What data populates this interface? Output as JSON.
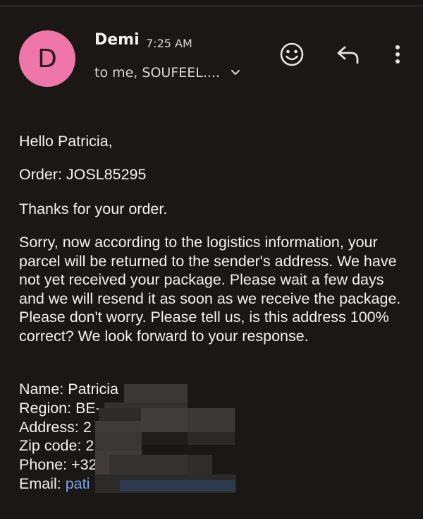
{
  "header": {
    "avatar_letter": "D",
    "sender_name": "Demi",
    "time": "7:25 AM",
    "recipients": "to me, SOUFEEL...."
  },
  "actions": {
    "emoji_icon": "smiley-icon",
    "reply_icon": "reply-arrow-icon",
    "more_icon": "vertical-dots-icon"
  },
  "message": {
    "greeting": "Hello Patricia,",
    "order": "Order: JOSL85295",
    "thanks": "Thanks for your order.",
    "paragraph": "Sorry, now according to the logistics information, your parcel will be returned to the sender's address. We have not yet received your package. Please wait a few days and we will resend it as soon as we receive the package. Please don't worry. Please tell us, is this address 100% correct? We look forward to your response."
  },
  "details": {
    "name": "Name: Patricia",
    "region": "Region: BE-",
    "address": "Address: 2",
    "zip": "Zip code: 2",
    "phone": "Phone: +324",
    "email_label": "Email: ",
    "email_value": "pati"
  },
  "colors": {
    "background": "#1a1714",
    "avatar": "#ef76a8",
    "link": "#7aa7ee"
  }
}
